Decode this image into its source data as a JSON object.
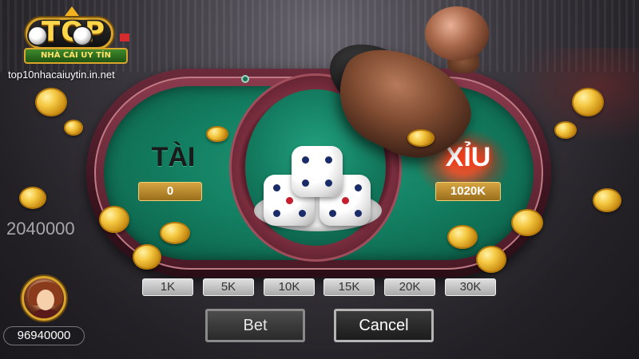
{
  "brand": {
    "logo_word": "TOP",
    "logo_subtitle": "NHÀ CÁI UY TÍN",
    "site_url": "top10nhacaiuytin.in.net"
  },
  "table": {
    "tai": {
      "label": "TÀI",
      "bet_value": "0"
    },
    "xiu": {
      "label": "XỈU",
      "bet_value": "1020K"
    },
    "dice": [
      4,
      5,
      5
    ]
  },
  "balance_display": "2040000",
  "chips": [
    "1K",
    "5K",
    "10K",
    "15K",
    "20K",
    "30K"
  ],
  "player": {
    "money": "96940000"
  },
  "actions": {
    "bet_label": "Bet",
    "cancel_label": "Cancel"
  },
  "colors": {
    "felt": "#137d60",
    "rail": "#6b2a3a",
    "gold": "#f5c842",
    "xiu_glow": "#ff3a1a"
  },
  "icons": [
    "crown-icon",
    "soccer-ball-icon",
    "flag-icon",
    "coin-icon",
    "dice-cup-icon",
    "avatar-icon"
  ]
}
